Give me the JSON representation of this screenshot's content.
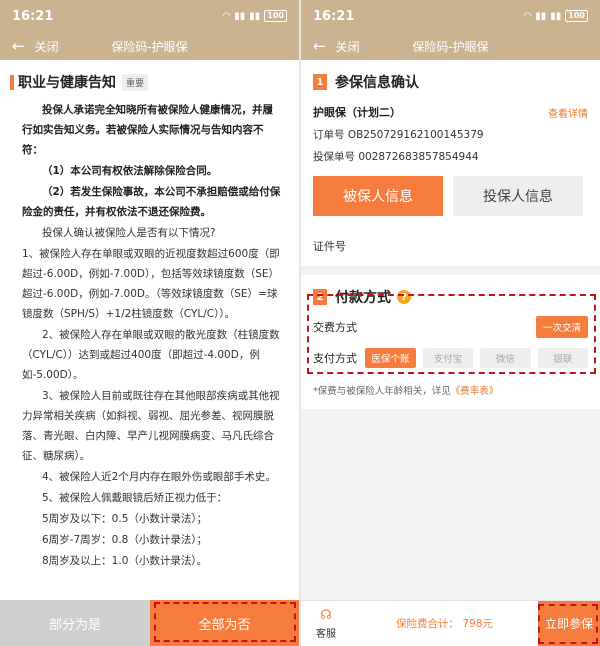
{
  "status": {
    "time": "16:21",
    "battery": "100"
  },
  "left": {
    "nav": {
      "close": "关闭",
      "title": "保险码-护眼保"
    },
    "heading": "职业与健康告知",
    "tag": "重要",
    "paragraphs": [
      "投保人承诺完全知晓所有被保险人健康情况，并履行如实告知义务。若被保险人实际情况与告知内容不符：",
      "（1）本公司有权依法解除保险合同。",
      "（2）若发生保险事故，本公司不承担赔偿或给付保险金的责任，并有权依法不退还保险费。"
    ],
    "question": "投保人确认被保险人是否有以下情况?",
    "items": [
      "1、被保险人存在单眼或双眼的近视度数超过600度（即超过-6.00D，例如-7.00D），包括等效球镜度数（SE）超过-6.00D，例如-7.00D。（等效球镜度数（SE）=球镜度数（SPH/S）+1/2柱镜度数（CYL/C））。",
      "2、被保险人存在单眼或双眼的散光度数（柱镜度数（CYL/C））达到或超过400度（即超过-4.00D，例如-5.00D）。",
      "3、被保险人目前或既往存在其他眼部疾病或其他视力异常相关疾病（如斜视、弱视、屈光参差、视网膜脱落、青光眼、白内障、早产儿视网膜病变、马凡氏综合征、糖尿病）。",
      "4、被保险人近2个月内存在眼外伤或眼部手术史。",
      "5、被保险人佩戴眼镜后矫正视力低于："
    ],
    "vision": [
      "5周岁及以下：0.5（小数计录法）；",
      "6周岁-7周岁：0.8（小数计录法）；",
      "8周岁及以上：1.0（小数计录法）。"
    ],
    "btn_partial": "部分为是",
    "btn_all_no": "全部为否"
  },
  "right": {
    "nav": {
      "close": "关闭",
      "title": "保险码-护眼保"
    },
    "section1": {
      "num": "1",
      "title": "参保信息确认"
    },
    "product": "护眼保（计划二）",
    "view_detail": "查看详情",
    "order_no": "订单号  OB250729162100145379",
    "policy_no": "投保单号  002872683857854944",
    "tab_insured": "被保人信息",
    "tab_holder": "投保人信息",
    "cert_label": "证件号",
    "section2": {
      "num": "2",
      "title": "付款方式",
      "help": "?"
    },
    "pay_mode_label": "交费方式",
    "pay_mode_value": "一次交清",
    "pay_method_label": "支付方式",
    "pay_methods": [
      "医保个账",
      "支付宝",
      "微信",
      "银联"
    ],
    "tip_text": "*保费与被保险人年龄相关，详见",
    "tip_link": "《费率表》",
    "service": "客服",
    "total": "保险费合计： 798元",
    "buy": "立即参保",
    "accent": "#f57c3c",
    "header_color": "#cbb38f",
    "highlight_color": "#c4121b"
  }
}
